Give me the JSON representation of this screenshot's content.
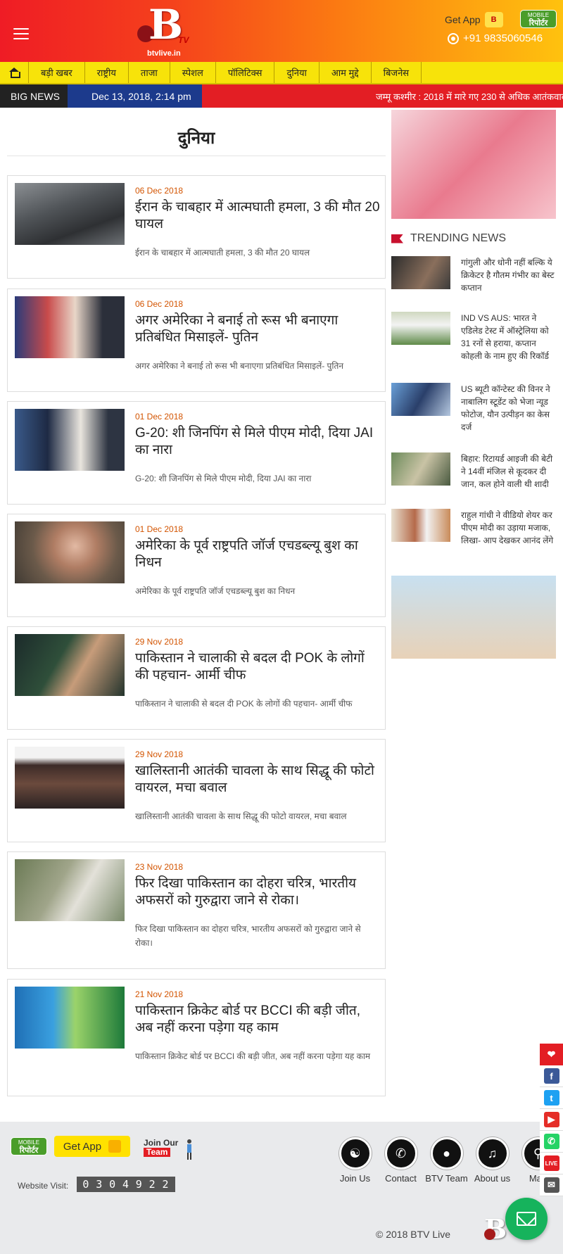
{
  "header": {
    "logo_letter": "B",
    "logo_tv": "TV",
    "logo_url": "btvlive.in",
    "get_app": "Get App",
    "mobile_reporter_top": "MOBILE",
    "mobile_reporter_bottom": "रिपोर्टर",
    "phone": "+91 9835060546"
  },
  "nav": {
    "items": [
      "बड़ी खबर",
      "राष्ट्रीय",
      "ताजा",
      "स्पेशल",
      "पॉलिटिक्स",
      "दुनिया",
      "आम मुद्दे",
      "बिजनेस"
    ]
  },
  "ticker": {
    "label": "BIG NEWS",
    "datetime": "Dec 13, 2018, 2:14 pm",
    "headline": "जम्मू कश्मीर : 2018 में मारे गए 230 से अधिक आतंकवादी"
  },
  "main": {
    "section_title": "दुनिया",
    "articles": [
      {
        "date": "06 Dec 2018",
        "title": "ईरान के चाबहार में आत्मघाती हमला, 3 की मौत 20 घायल",
        "desc": "ईरान के चाबहार में आत्मघाती हमला, 3 की मौत 20 घायल"
      },
      {
        "date": "06 Dec 2018",
        "title": "अगर अमेरिका ने बनाई तो रूस भी बनाएगा प्रतिबंधित मिसाइलें- पुतिन",
        "desc": "अगर अमेरिका ने बनाई तो रूस भी बनाएगा प्रतिबंधित मिसाइलें- पुतिन"
      },
      {
        "date": "01 Dec 2018",
        "title": "G-20: शी जिनपिंग से मिले पीएम मोदी, दिया JAI का नारा",
        "desc": "G-20: शी जिनपिंग से मिले पीएम मोदी, दिया JAI का नारा"
      },
      {
        "date": "01 Dec 2018",
        "title": "अमेरिका के पूर्व राष्ट्रपति जॉर्ज एचडब्ल्यू बुश का निधन",
        "desc": "अमेरिका के पूर्व राष्ट्रपति जॉर्ज एचडब्ल्यू बुश का निधन"
      },
      {
        "date": "29 Nov 2018",
        "title": "पाकिस्तान ने चालाकी से बदल दी POK के लोगों की पहचान- आर्मी चीफ",
        "desc": "पाकिस्तान ने चालाकी से बदल दी POK के लोगों की पहचान- आर्मी चीफ"
      },
      {
        "date": "29 Nov 2018",
        "title": "खालिस्तानी आतंकी चावला के साथ सिद्धू की फोटो वायरल, मचा बवाल",
        "desc": "खालिस्तानी आतंकी चावला के साथ सिद्धू की फोटो वायरल, मचा बवाल"
      },
      {
        "date": "23 Nov 2018",
        "title": "फिर दिखा पाकिस्तान का दोहरा चरित्र, भारतीय अफसरों को गुरुद्वारा जाने से रोका।",
        "desc": "फिर दिखा पाकिस्तान का दोहरा चरित्र, भारतीय अफसरों को गुरुद्वारा जाने से रोका।"
      },
      {
        "date": "21 Nov 2018",
        "title": "पाकिस्तान क्रिकेट बोर्ड पर BCCI की बड़ी जीत, अब नहीं करना पड़ेगा यह काम",
        "desc": "पाकिस्तान क्रिकेट बोर्ड पर BCCI की बड़ी जीत, अब नहीं करना पड़ेगा यह काम"
      }
    ]
  },
  "sidebar": {
    "trending_title": "TRENDING NEWS",
    "trending": [
      "गांगुली और धोनी नहीं बल्कि ये क्रिकेटर है गौतम गंभीर का बेस्ट कप्तान",
      "IND VS AUS: भारत ने एडिलेड टेस्ट में ऑस्ट्रेलिया को 31 रनों से हराया, कप्तान कोहली के नाम हुए की रिकॉर्ड",
      "US ब्यूटी कॉन्टेस्ट की विनर ने नाबालिग स्टूडेंट को भेजा न्यूड फोटोज, यौन उत्पीड़न का केस दर्ज",
      "बिहार: रिटायर्ड आइजी की बेटी ने 14वीं मंजिल से कूदकर दी जान, कल होने वाली थी शादी",
      "राहुल गांधी ने वीडियो शेयर कर पीएम मोदी का उड़ाया मजाक, लिखा- आप देखकर आनंद लेंगे"
    ]
  },
  "footer": {
    "get_app": "Get App",
    "join_line1": "Join Our",
    "join_line2": "Team",
    "website_visit_label": "Website Visit:",
    "visit_count": [
      "0",
      "3",
      "0",
      "4",
      "9",
      "2",
      "2"
    ],
    "links": [
      "Join Us",
      "Contact",
      "BTV Team",
      "About us",
      "Map"
    ],
    "copyright": "© 2018 BTV Live"
  },
  "social": {
    "icons": [
      "heart-icon",
      "facebook-icon",
      "twitter-icon",
      "youtube-icon",
      "whatsapp-icon",
      "live-icon",
      "mail-icon"
    ],
    "colors": {
      "heart": "#e31e24",
      "facebook": "#3b5998",
      "twitter": "#1da1f2",
      "youtube": "#e52d27",
      "whatsapp": "#25d366"
    }
  },
  "colors": {
    "header_red": "#ef1c25",
    "header_yellow": "#ffc20e",
    "nav_yellow": "#f7e30a",
    "ticker_red": "#e31e24",
    "ticker_blue": "#1c3a8c",
    "date_orange": "#d35400",
    "chat_green": "#16b35c"
  }
}
